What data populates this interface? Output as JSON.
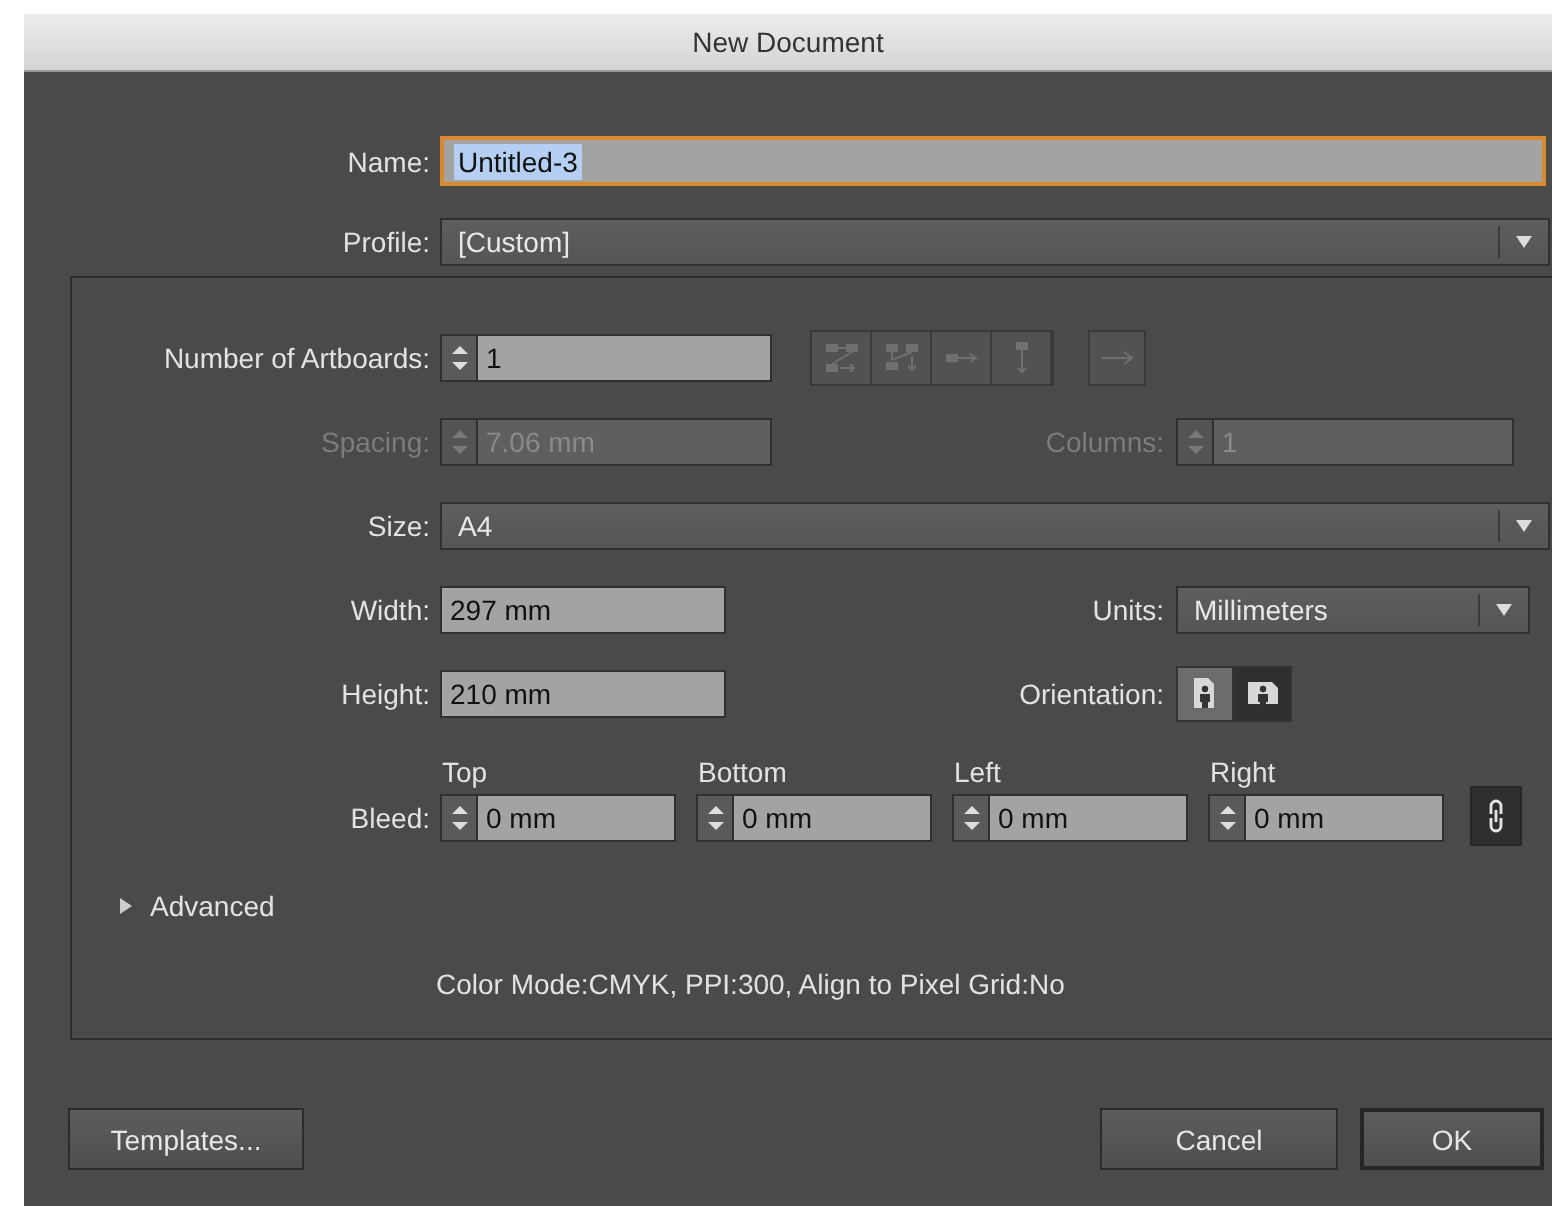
{
  "window": {
    "title": "New Document"
  },
  "name": {
    "label": "Name:",
    "value": "Untitled-3",
    "focused": true
  },
  "profile": {
    "label": "Profile:",
    "value": "[Custom]"
  },
  "artboards": {
    "label": "Number of Artboards:",
    "value": "1",
    "layout_disabled": true
  },
  "spacing": {
    "label": "Spacing:",
    "value": "7.06 mm",
    "disabled": true
  },
  "columns": {
    "label": "Columns:",
    "value": "1",
    "disabled": true
  },
  "size": {
    "label": "Size:",
    "value": "A4"
  },
  "width": {
    "label": "Width:",
    "value": "297 mm"
  },
  "units": {
    "label": "Units:",
    "value": "Millimeters"
  },
  "height": {
    "label": "Height:",
    "value": "210 mm"
  },
  "orientation": {
    "label": "Orientation:",
    "options": [
      {
        "kind": "portrait",
        "selected": false
      },
      {
        "kind": "landscape",
        "selected": true
      }
    ]
  },
  "bleed": {
    "label": "Bleed:",
    "fields": [
      {
        "heading": "Top",
        "value": "0 mm"
      },
      {
        "heading": "Bottom",
        "value": "0 mm"
      },
      {
        "heading": "Left",
        "value": "0 mm"
      },
      {
        "heading": "Right",
        "value": "0 mm"
      }
    ]
  },
  "advanced": {
    "label": "Advanced",
    "expanded": false
  },
  "summary": "Color Mode:CMYK, PPI:300, Align to Pixel Grid:No",
  "templates_button": "Templates...",
  "buttons": [
    {
      "label": "Cancel",
      "default": false
    },
    {
      "label": "OK",
      "default": true
    }
  ]
}
